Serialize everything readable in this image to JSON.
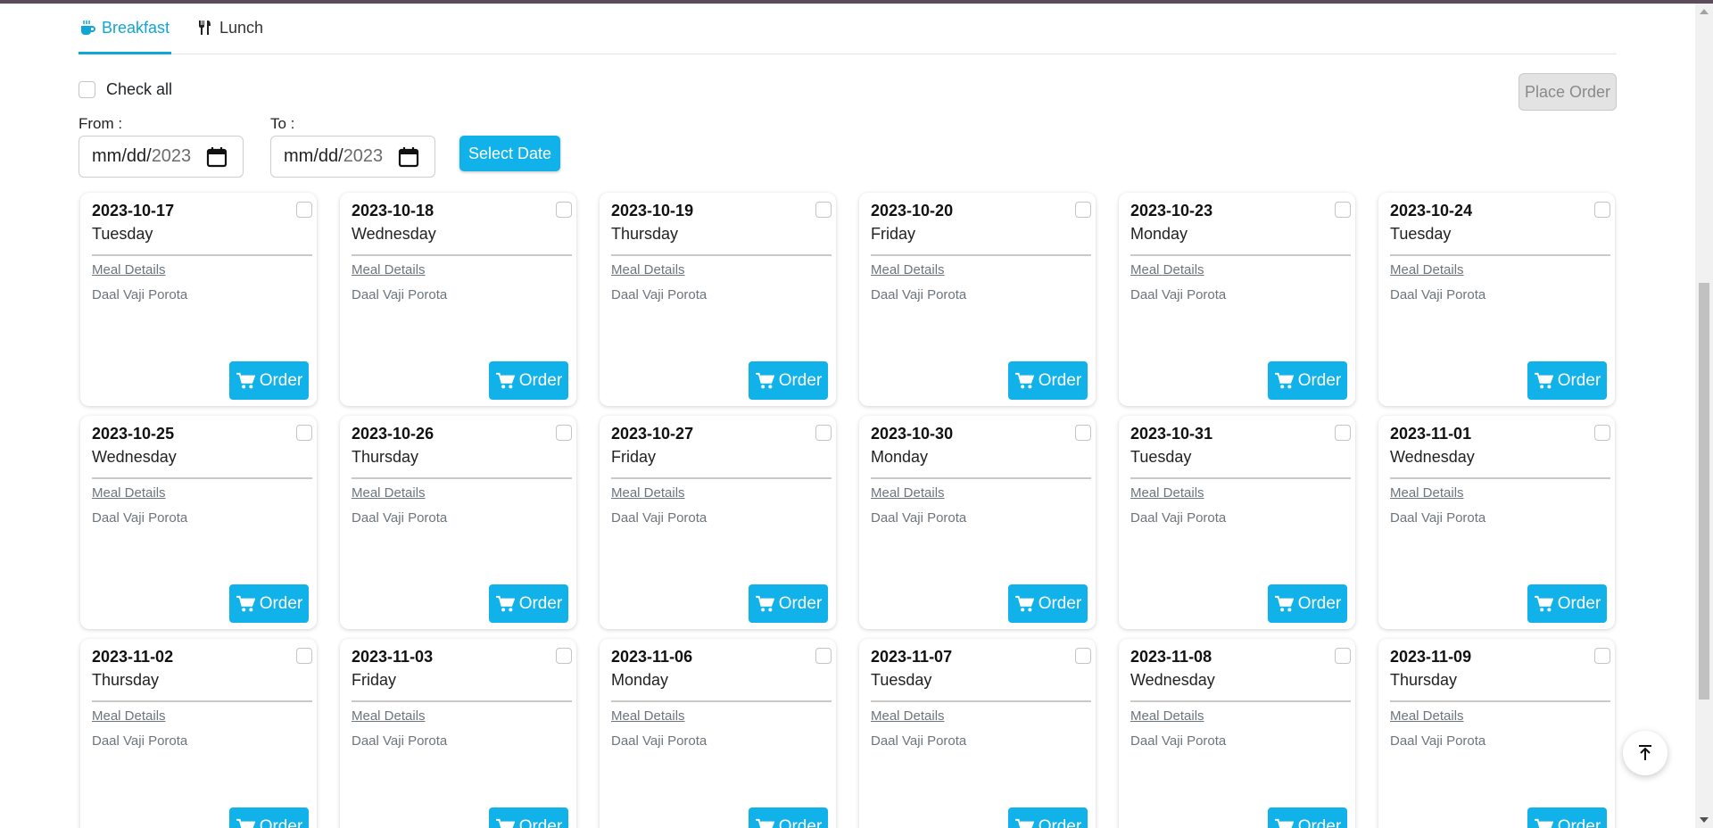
{
  "tabs": [
    {
      "label": "Breakfast",
      "icon": "coffee-cup-icon",
      "active": true
    },
    {
      "label": "Lunch",
      "icon": "utensils-icon",
      "active": false
    }
  ],
  "controls": {
    "check_all_label": "Check all",
    "place_order_label": "Place Order",
    "from_label": "From :",
    "to_label": "To :",
    "from_value_mask": "mm/dd/",
    "from_value_year": "2023",
    "to_value_mask": "mm/dd/",
    "to_value_year": "2023",
    "select_date_label": "Select Date"
  },
  "card_common": {
    "meal_details_label": "Meal Details",
    "order_label": "Order"
  },
  "cards": [
    {
      "date": "2023-10-17",
      "day": "Tuesday",
      "meal": "Daal Vaji Porota"
    },
    {
      "date": "2023-10-18",
      "day": "Wednesday",
      "meal": "Daal Vaji Porota"
    },
    {
      "date": "2023-10-19",
      "day": "Thursday",
      "meal": "Daal Vaji Porota"
    },
    {
      "date": "2023-10-20",
      "day": "Friday",
      "meal": "Daal Vaji Porota"
    },
    {
      "date": "2023-10-23",
      "day": "Monday",
      "meal": "Daal Vaji Porota"
    },
    {
      "date": "2023-10-24",
      "day": "Tuesday",
      "meal": "Daal Vaji Porota"
    },
    {
      "date": "2023-10-25",
      "day": "Wednesday",
      "meal": "Daal Vaji Porota"
    },
    {
      "date": "2023-10-26",
      "day": "Thursday",
      "meal": "Daal Vaji Porota"
    },
    {
      "date": "2023-10-27",
      "day": "Friday",
      "meal": "Daal Vaji Porota"
    },
    {
      "date": "2023-10-30",
      "day": "Monday",
      "meal": "Daal Vaji Porota"
    },
    {
      "date": "2023-10-31",
      "day": "Tuesday",
      "meal": "Daal Vaji Porota"
    },
    {
      "date": "2023-11-01",
      "day": "Wednesday",
      "meal": "Daal Vaji Porota"
    },
    {
      "date": "2023-11-02",
      "day": "Thursday",
      "meal": "Daal Vaji Porota"
    },
    {
      "date": "2023-11-03",
      "day": "Friday",
      "meal": "Daal Vaji Porota"
    },
    {
      "date": "2023-11-06",
      "day": "Monday",
      "meal": "Daal Vaji Porota"
    },
    {
      "date": "2023-11-07",
      "day": "Tuesday",
      "meal": "Daal Vaji Porota"
    },
    {
      "date": "2023-11-08",
      "day": "Wednesday",
      "meal": "Daal Vaji Porota"
    },
    {
      "date": "2023-11-09",
      "day": "Thursday",
      "meal": "Daal Vaji Porota"
    }
  ],
  "colors": {
    "accent": "#11b2ea",
    "tab_active": "#0fa5d6",
    "muted_text": "#6c757d",
    "disabled_button_bg": "#e3e3e3"
  },
  "icons": {
    "calendar": "calendar-icon",
    "cart": "cart-icon",
    "back_to_top": "arrow-up-to-line-icon"
  }
}
